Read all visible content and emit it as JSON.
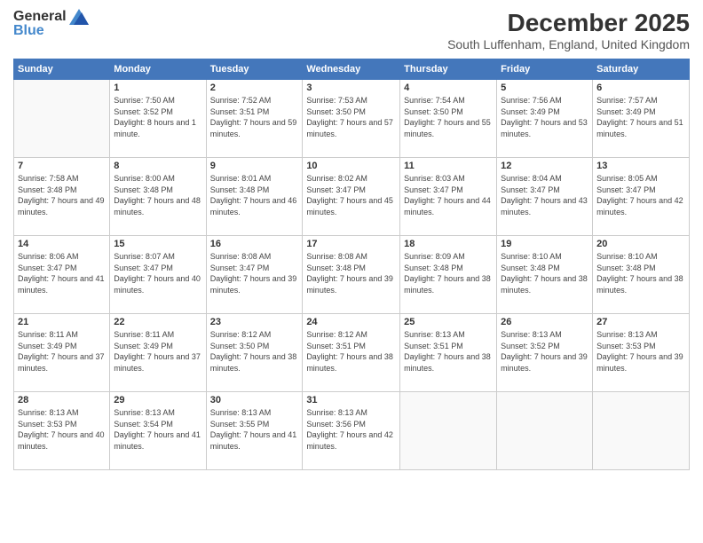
{
  "logo": {
    "general": "General",
    "blue": "Blue"
  },
  "title": {
    "month": "December 2025",
    "location": "South Luffenham, England, United Kingdom"
  },
  "weekdays": [
    "Sunday",
    "Monday",
    "Tuesday",
    "Wednesday",
    "Thursday",
    "Friday",
    "Saturday"
  ],
  "weeks": [
    [
      {
        "day": "",
        "sunrise": "",
        "sunset": "",
        "daylight": ""
      },
      {
        "day": "1",
        "sunrise": "Sunrise: 7:50 AM",
        "sunset": "Sunset: 3:52 PM",
        "daylight": "Daylight: 8 hours and 1 minute."
      },
      {
        "day": "2",
        "sunrise": "Sunrise: 7:52 AM",
        "sunset": "Sunset: 3:51 PM",
        "daylight": "Daylight: 7 hours and 59 minutes."
      },
      {
        "day": "3",
        "sunrise": "Sunrise: 7:53 AM",
        "sunset": "Sunset: 3:50 PM",
        "daylight": "Daylight: 7 hours and 57 minutes."
      },
      {
        "day": "4",
        "sunrise": "Sunrise: 7:54 AM",
        "sunset": "Sunset: 3:50 PM",
        "daylight": "Daylight: 7 hours and 55 minutes."
      },
      {
        "day": "5",
        "sunrise": "Sunrise: 7:56 AM",
        "sunset": "Sunset: 3:49 PM",
        "daylight": "Daylight: 7 hours and 53 minutes."
      },
      {
        "day": "6",
        "sunrise": "Sunrise: 7:57 AM",
        "sunset": "Sunset: 3:49 PM",
        "daylight": "Daylight: 7 hours and 51 minutes."
      }
    ],
    [
      {
        "day": "7",
        "sunrise": "Sunrise: 7:58 AM",
        "sunset": "Sunset: 3:48 PM",
        "daylight": "Daylight: 7 hours and 49 minutes."
      },
      {
        "day": "8",
        "sunrise": "Sunrise: 8:00 AM",
        "sunset": "Sunset: 3:48 PM",
        "daylight": "Daylight: 7 hours and 48 minutes."
      },
      {
        "day": "9",
        "sunrise": "Sunrise: 8:01 AM",
        "sunset": "Sunset: 3:48 PM",
        "daylight": "Daylight: 7 hours and 46 minutes."
      },
      {
        "day": "10",
        "sunrise": "Sunrise: 8:02 AM",
        "sunset": "Sunset: 3:47 PM",
        "daylight": "Daylight: 7 hours and 45 minutes."
      },
      {
        "day": "11",
        "sunrise": "Sunrise: 8:03 AM",
        "sunset": "Sunset: 3:47 PM",
        "daylight": "Daylight: 7 hours and 44 minutes."
      },
      {
        "day": "12",
        "sunrise": "Sunrise: 8:04 AM",
        "sunset": "Sunset: 3:47 PM",
        "daylight": "Daylight: 7 hours and 43 minutes."
      },
      {
        "day": "13",
        "sunrise": "Sunrise: 8:05 AM",
        "sunset": "Sunset: 3:47 PM",
        "daylight": "Daylight: 7 hours and 42 minutes."
      }
    ],
    [
      {
        "day": "14",
        "sunrise": "Sunrise: 8:06 AM",
        "sunset": "Sunset: 3:47 PM",
        "daylight": "Daylight: 7 hours and 41 minutes."
      },
      {
        "day": "15",
        "sunrise": "Sunrise: 8:07 AM",
        "sunset": "Sunset: 3:47 PM",
        "daylight": "Daylight: 7 hours and 40 minutes."
      },
      {
        "day": "16",
        "sunrise": "Sunrise: 8:08 AM",
        "sunset": "Sunset: 3:47 PM",
        "daylight": "Daylight: 7 hours and 39 minutes."
      },
      {
        "day": "17",
        "sunrise": "Sunrise: 8:08 AM",
        "sunset": "Sunset: 3:48 PM",
        "daylight": "Daylight: 7 hours and 39 minutes."
      },
      {
        "day": "18",
        "sunrise": "Sunrise: 8:09 AM",
        "sunset": "Sunset: 3:48 PM",
        "daylight": "Daylight: 7 hours and 38 minutes."
      },
      {
        "day": "19",
        "sunrise": "Sunrise: 8:10 AM",
        "sunset": "Sunset: 3:48 PM",
        "daylight": "Daylight: 7 hours and 38 minutes."
      },
      {
        "day": "20",
        "sunrise": "Sunrise: 8:10 AM",
        "sunset": "Sunset: 3:48 PM",
        "daylight": "Daylight: 7 hours and 38 minutes."
      }
    ],
    [
      {
        "day": "21",
        "sunrise": "Sunrise: 8:11 AM",
        "sunset": "Sunset: 3:49 PM",
        "daylight": "Daylight: 7 hours and 37 minutes."
      },
      {
        "day": "22",
        "sunrise": "Sunrise: 8:11 AM",
        "sunset": "Sunset: 3:49 PM",
        "daylight": "Daylight: 7 hours and 37 minutes."
      },
      {
        "day": "23",
        "sunrise": "Sunrise: 8:12 AM",
        "sunset": "Sunset: 3:50 PM",
        "daylight": "Daylight: 7 hours and 38 minutes."
      },
      {
        "day": "24",
        "sunrise": "Sunrise: 8:12 AM",
        "sunset": "Sunset: 3:51 PM",
        "daylight": "Daylight: 7 hours and 38 minutes."
      },
      {
        "day": "25",
        "sunrise": "Sunrise: 8:13 AM",
        "sunset": "Sunset: 3:51 PM",
        "daylight": "Daylight: 7 hours and 38 minutes."
      },
      {
        "day": "26",
        "sunrise": "Sunrise: 8:13 AM",
        "sunset": "Sunset: 3:52 PM",
        "daylight": "Daylight: 7 hours and 39 minutes."
      },
      {
        "day": "27",
        "sunrise": "Sunrise: 8:13 AM",
        "sunset": "Sunset: 3:53 PM",
        "daylight": "Daylight: 7 hours and 39 minutes."
      }
    ],
    [
      {
        "day": "28",
        "sunrise": "Sunrise: 8:13 AM",
        "sunset": "Sunset: 3:53 PM",
        "daylight": "Daylight: 7 hours and 40 minutes."
      },
      {
        "day": "29",
        "sunrise": "Sunrise: 8:13 AM",
        "sunset": "Sunset: 3:54 PM",
        "daylight": "Daylight: 7 hours and 41 minutes."
      },
      {
        "day": "30",
        "sunrise": "Sunrise: 8:13 AM",
        "sunset": "Sunset: 3:55 PM",
        "daylight": "Daylight: 7 hours and 41 minutes."
      },
      {
        "day": "31",
        "sunrise": "Sunrise: 8:13 AM",
        "sunset": "Sunset: 3:56 PM",
        "daylight": "Daylight: 7 hours and 42 minutes."
      },
      {
        "day": "",
        "sunrise": "",
        "sunset": "",
        "daylight": ""
      },
      {
        "day": "",
        "sunrise": "",
        "sunset": "",
        "daylight": ""
      },
      {
        "day": "",
        "sunrise": "",
        "sunset": "",
        "daylight": ""
      }
    ]
  ]
}
